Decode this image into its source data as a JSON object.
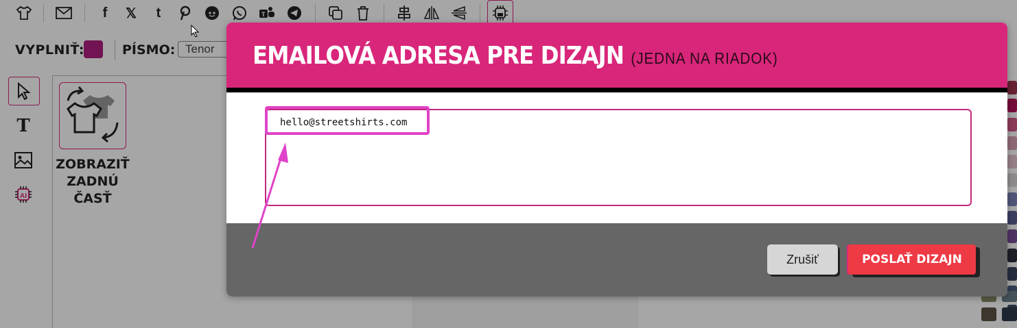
{
  "toolbar": {
    "icons": [
      "tshirt-icon",
      "mail-icon",
      "facebook-icon",
      "x-icon",
      "tumblr-icon",
      "pinterest-icon",
      "reddit-icon",
      "whatsapp-icon",
      "teams-icon",
      "telegram-icon",
      "duplicate-icon",
      "trash-icon",
      "align-center-icon",
      "flip-horizontal-icon",
      "flip-vertical-icon",
      "ai-icon"
    ]
  },
  "properties": {
    "fill_label": "VYPLNIŤ:",
    "fill_color": "#b01e80",
    "font_label": "PÍSMO:",
    "font_value": "Tenor"
  },
  "left_tools": [
    "pointer-icon",
    "text-icon",
    "image-icon",
    "ai-chip-icon"
  ],
  "back_view": {
    "label_line1": "ZOBRAZIŤ",
    "label_line2": "ZADNÚ",
    "label_line3": "ČASŤ"
  },
  "modal": {
    "title": "EMAILOVÁ ADRESA PRE DIZAJN",
    "subtitle": "(JEDNA NA RIADOK)",
    "email_value": "hello@streetshirts.com",
    "cancel_label": "Zrušiť",
    "send_label": "POSLAŤ DIZAJN"
  },
  "colors": {
    "accent": "#d8267a",
    "send_button": "#ee3a45",
    "footer": "#666666"
  }
}
